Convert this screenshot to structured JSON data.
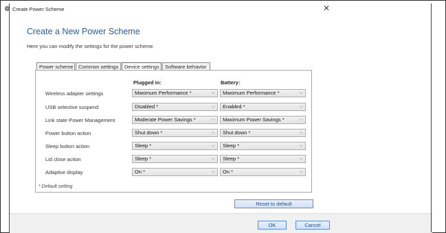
{
  "window": {
    "title": "Create Power Scheme"
  },
  "heading": "Create a New Power Scheme",
  "intro": "Here you can modify the settings for the power scheme.",
  "tabs": [
    {
      "label": "Power scheme"
    },
    {
      "label": "Common settings"
    },
    {
      "label": "Device settings"
    },
    {
      "label": "Software behavior"
    }
  ],
  "columns": {
    "plugged": "Plugged in:",
    "battery": "Battery:"
  },
  "rows": [
    {
      "label": "Wireless adapter settings",
      "plugged": "Maximum Performance *",
      "battery": "Maximum Performance *"
    },
    {
      "label": "USB selective suspend",
      "plugged": "Disabled *",
      "battery": "Enabled *"
    },
    {
      "label": "Link state Power Management",
      "plugged": "Moderate Power Savings *",
      "battery": "Maximum Power Savings *"
    },
    {
      "label": "Power button action",
      "plugged": "Shut down *",
      "battery": "Shut down *"
    },
    {
      "label": "Sleep button action",
      "plugged": "Sleep *",
      "battery": "Sleep *"
    },
    {
      "label": "Lid close action",
      "plugged": "Sleep *",
      "battery": "Sleep *"
    },
    {
      "label": "Adaptive display",
      "plugged": "On *",
      "battery": "On *"
    }
  ],
  "footnote": "* Default setting",
  "buttons": {
    "reset": "Reset to default",
    "ok": "OK",
    "cancel": "Cancel"
  }
}
